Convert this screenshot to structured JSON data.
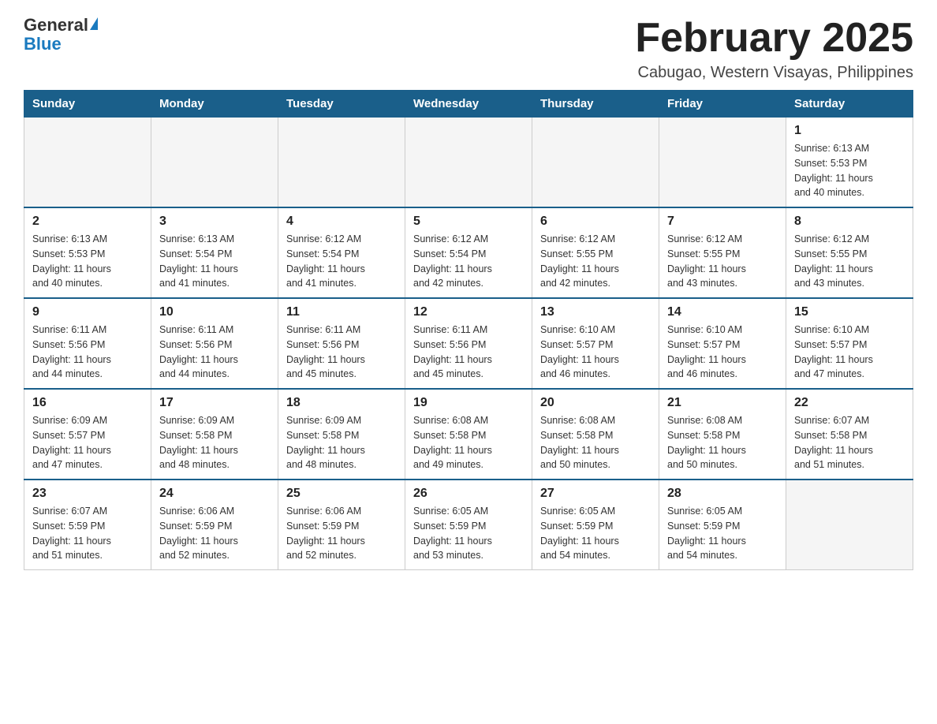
{
  "logo": {
    "general": "General",
    "blue": "Blue"
  },
  "header": {
    "month": "February 2025",
    "location": "Cabugao, Western Visayas, Philippines"
  },
  "weekdays": [
    "Sunday",
    "Monday",
    "Tuesday",
    "Wednesday",
    "Thursday",
    "Friday",
    "Saturday"
  ],
  "weeks": [
    {
      "days": [
        {
          "num": "",
          "info": ""
        },
        {
          "num": "",
          "info": ""
        },
        {
          "num": "",
          "info": ""
        },
        {
          "num": "",
          "info": ""
        },
        {
          "num": "",
          "info": ""
        },
        {
          "num": "",
          "info": ""
        },
        {
          "num": "1",
          "info": "Sunrise: 6:13 AM\nSunset: 5:53 PM\nDaylight: 11 hours\nand 40 minutes."
        }
      ]
    },
    {
      "days": [
        {
          "num": "2",
          "info": "Sunrise: 6:13 AM\nSunset: 5:53 PM\nDaylight: 11 hours\nand 40 minutes."
        },
        {
          "num": "3",
          "info": "Sunrise: 6:13 AM\nSunset: 5:54 PM\nDaylight: 11 hours\nand 41 minutes."
        },
        {
          "num": "4",
          "info": "Sunrise: 6:12 AM\nSunset: 5:54 PM\nDaylight: 11 hours\nand 41 minutes."
        },
        {
          "num": "5",
          "info": "Sunrise: 6:12 AM\nSunset: 5:54 PM\nDaylight: 11 hours\nand 42 minutes."
        },
        {
          "num": "6",
          "info": "Sunrise: 6:12 AM\nSunset: 5:55 PM\nDaylight: 11 hours\nand 42 minutes."
        },
        {
          "num": "7",
          "info": "Sunrise: 6:12 AM\nSunset: 5:55 PM\nDaylight: 11 hours\nand 43 minutes."
        },
        {
          "num": "8",
          "info": "Sunrise: 6:12 AM\nSunset: 5:55 PM\nDaylight: 11 hours\nand 43 minutes."
        }
      ]
    },
    {
      "days": [
        {
          "num": "9",
          "info": "Sunrise: 6:11 AM\nSunset: 5:56 PM\nDaylight: 11 hours\nand 44 minutes."
        },
        {
          "num": "10",
          "info": "Sunrise: 6:11 AM\nSunset: 5:56 PM\nDaylight: 11 hours\nand 44 minutes."
        },
        {
          "num": "11",
          "info": "Sunrise: 6:11 AM\nSunset: 5:56 PM\nDaylight: 11 hours\nand 45 minutes."
        },
        {
          "num": "12",
          "info": "Sunrise: 6:11 AM\nSunset: 5:56 PM\nDaylight: 11 hours\nand 45 minutes."
        },
        {
          "num": "13",
          "info": "Sunrise: 6:10 AM\nSunset: 5:57 PM\nDaylight: 11 hours\nand 46 minutes."
        },
        {
          "num": "14",
          "info": "Sunrise: 6:10 AM\nSunset: 5:57 PM\nDaylight: 11 hours\nand 46 minutes."
        },
        {
          "num": "15",
          "info": "Sunrise: 6:10 AM\nSunset: 5:57 PM\nDaylight: 11 hours\nand 47 minutes."
        }
      ]
    },
    {
      "days": [
        {
          "num": "16",
          "info": "Sunrise: 6:09 AM\nSunset: 5:57 PM\nDaylight: 11 hours\nand 47 minutes."
        },
        {
          "num": "17",
          "info": "Sunrise: 6:09 AM\nSunset: 5:58 PM\nDaylight: 11 hours\nand 48 minutes."
        },
        {
          "num": "18",
          "info": "Sunrise: 6:09 AM\nSunset: 5:58 PM\nDaylight: 11 hours\nand 48 minutes."
        },
        {
          "num": "19",
          "info": "Sunrise: 6:08 AM\nSunset: 5:58 PM\nDaylight: 11 hours\nand 49 minutes."
        },
        {
          "num": "20",
          "info": "Sunrise: 6:08 AM\nSunset: 5:58 PM\nDaylight: 11 hours\nand 50 minutes."
        },
        {
          "num": "21",
          "info": "Sunrise: 6:08 AM\nSunset: 5:58 PM\nDaylight: 11 hours\nand 50 minutes."
        },
        {
          "num": "22",
          "info": "Sunrise: 6:07 AM\nSunset: 5:58 PM\nDaylight: 11 hours\nand 51 minutes."
        }
      ]
    },
    {
      "days": [
        {
          "num": "23",
          "info": "Sunrise: 6:07 AM\nSunset: 5:59 PM\nDaylight: 11 hours\nand 51 minutes."
        },
        {
          "num": "24",
          "info": "Sunrise: 6:06 AM\nSunset: 5:59 PM\nDaylight: 11 hours\nand 52 minutes."
        },
        {
          "num": "25",
          "info": "Sunrise: 6:06 AM\nSunset: 5:59 PM\nDaylight: 11 hours\nand 52 minutes."
        },
        {
          "num": "26",
          "info": "Sunrise: 6:05 AM\nSunset: 5:59 PM\nDaylight: 11 hours\nand 53 minutes."
        },
        {
          "num": "27",
          "info": "Sunrise: 6:05 AM\nSunset: 5:59 PM\nDaylight: 11 hours\nand 54 minutes."
        },
        {
          "num": "28",
          "info": "Sunrise: 6:05 AM\nSunset: 5:59 PM\nDaylight: 11 hours\nand 54 minutes."
        },
        {
          "num": "",
          "info": ""
        }
      ]
    }
  ]
}
